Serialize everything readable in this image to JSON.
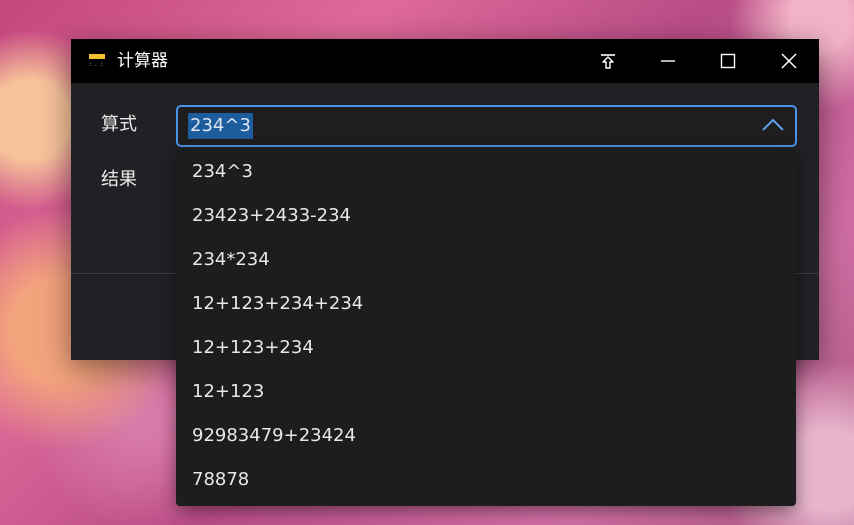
{
  "window": {
    "title": "计算器",
    "icons": {
      "app": "calculator-icon",
      "pin": "pin-top-icon",
      "minimize": "minimize-icon",
      "maximize": "maximize-icon",
      "close": "close-icon"
    }
  },
  "form": {
    "expression_label": "算式",
    "result_label": "结果",
    "expression_value": "234^3"
  },
  "history": {
    "items": [
      "234^3",
      "23423+2433-234",
      "234*234",
      "12+123+234+234",
      "12+123+234",
      "12+123",
      "92983479+23424",
      "78878"
    ]
  },
  "colors": {
    "accent": "#4a92ea",
    "selection": "#1d5d9e",
    "window_bg": "#202124",
    "titlebar_bg": "#000000",
    "dropdown_bg": "#1d1d1e"
  }
}
